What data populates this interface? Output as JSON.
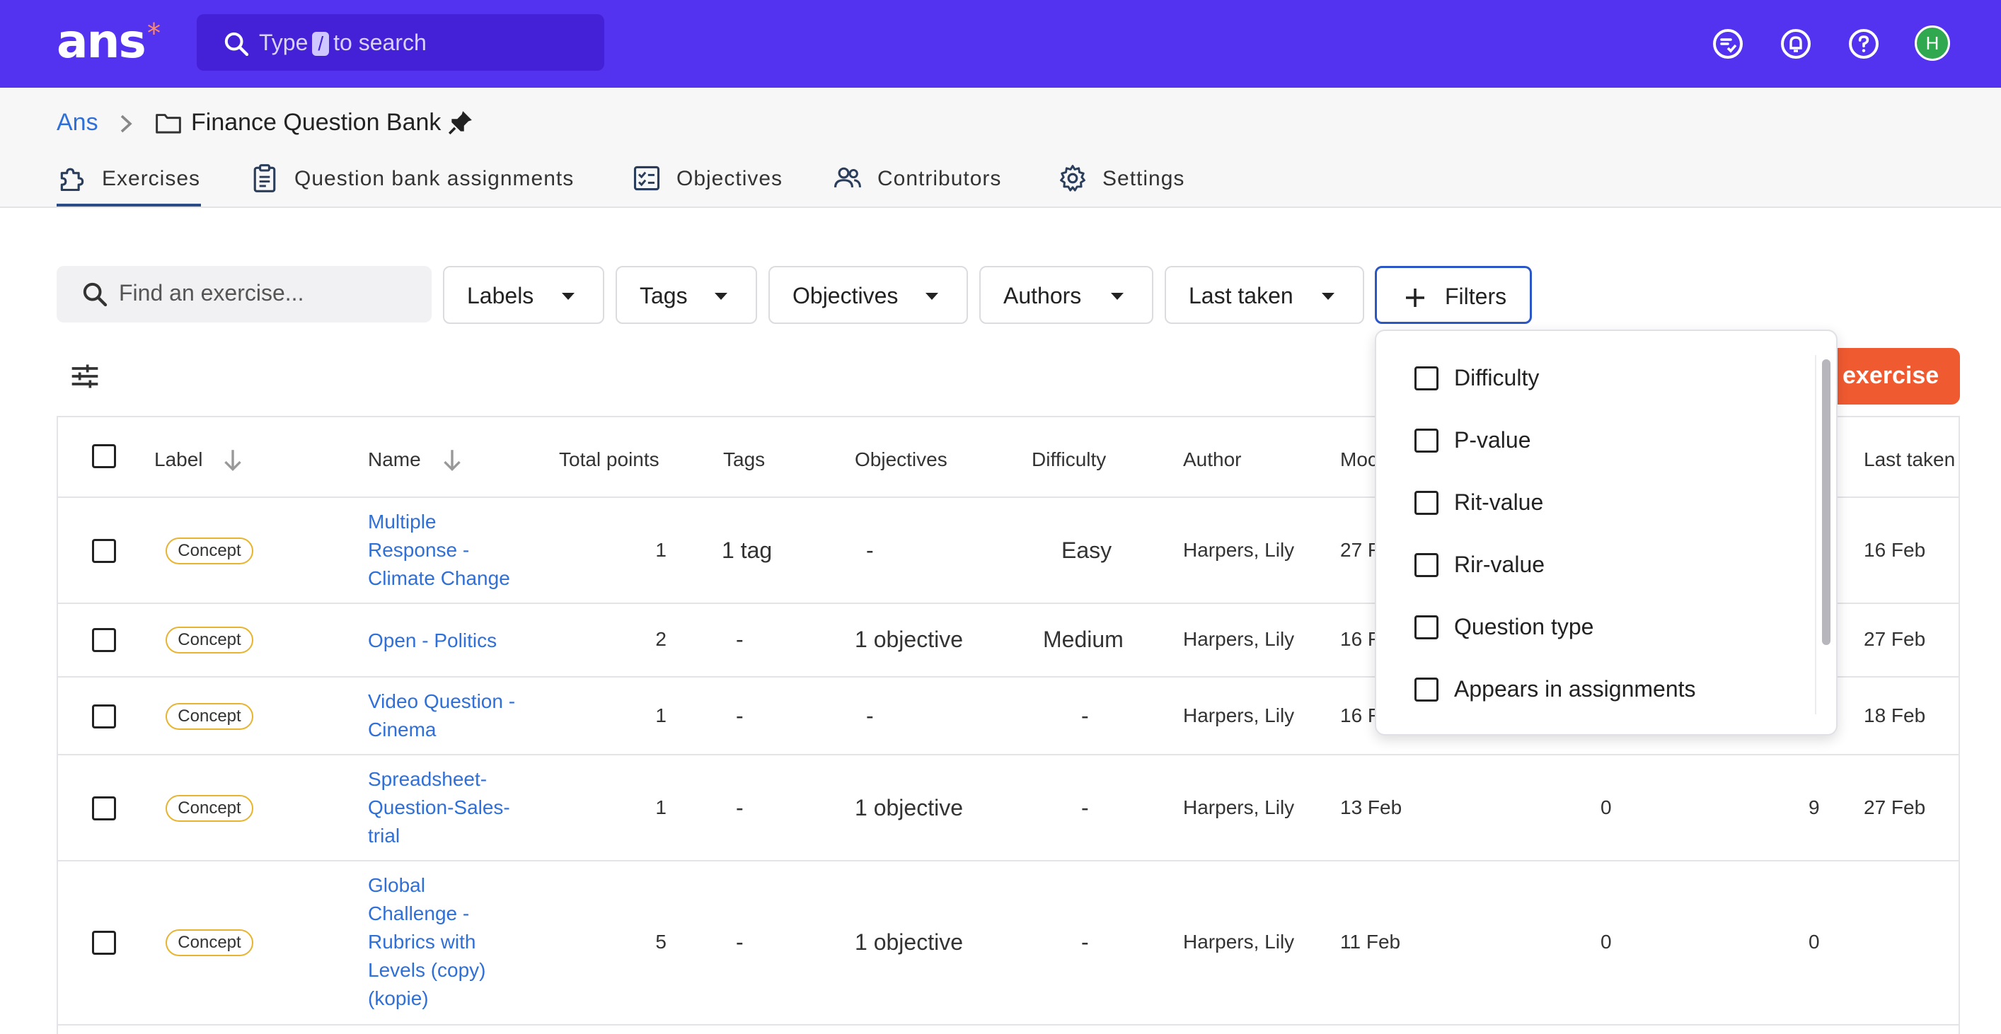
{
  "app": {
    "logo": "ans",
    "logo_star": "*",
    "search_prefix": "Type",
    "search_key": "/",
    "search_suffix": "to search",
    "avatar_initial": "H"
  },
  "breadcrumb": {
    "root": "Ans",
    "title": "Finance Question Bank"
  },
  "tabs": [
    {
      "label": "Exercises",
      "icon": "puzzle-icon",
      "active": true
    },
    {
      "label": "Question bank assignments",
      "icon": "clipboard-icon"
    },
    {
      "label": "Objectives",
      "icon": "checklist-icon"
    },
    {
      "label": "Contributors",
      "icon": "people-icon"
    },
    {
      "label": "Settings",
      "icon": "gear-icon"
    }
  ],
  "filters": {
    "search_placeholder": "Find an exercise...",
    "labels": "Labels",
    "tags": "Tags",
    "objectives": "Objectives",
    "authors": "Authors",
    "last_taken": "Last taken",
    "filters": "Filters"
  },
  "new_exercise_label": "exercise",
  "table": {
    "headers": {
      "label": "Label",
      "name": "Name",
      "total_points": "Total points",
      "tags": "Tags",
      "objectives": "Objectives",
      "difficulty": "Difficulty",
      "author": "Author",
      "modified": "Moc",
      "last_taken": "Last taken"
    },
    "rows": [
      {
        "label": "Concept",
        "name": "Multiple Response - Climate Change",
        "points": "1",
        "tags": "1 tag",
        "objectives": "-",
        "difficulty": "Easy",
        "author": "Harpers, Lily",
        "modified": "27 F",
        "col_a": "",
        "col_b": "",
        "last_taken": "16 Feb"
      },
      {
        "label": "Concept",
        "name": "Open - Politics",
        "points": "2",
        "tags": "-",
        "objectives": "1 objective",
        "difficulty": "Medium",
        "author": "Harpers, Lily",
        "modified": "16 F",
        "col_a": "",
        "col_b": "",
        "last_taken": "27 Feb"
      },
      {
        "label": "Concept",
        "name": "Video Question - Cinema",
        "points": "1",
        "tags": "-",
        "objectives": "-",
        "difficulty": "-",
        "author": "Harpers, Lily",
        "modified": "16 F",
        "col_a": "",
        "col_b": "",
        "last_taken": "18 Feb"
      },
      {
        "label": "Concept",
        "name": "Spreadsheet-Question-Sales-trial",
        "points": "1",
        "tags": "-",
        "objectives": "1 objective",
        "difficulty": "-",
        "author": "Harpers, Lily",
        "modified": "13 Feb",
        "col_a": "0",
        "col_b": "9",
        "last_taken": "27 Feb"
      },
      {
        "label": "Concept",
        "name": "Global Challenge - Rubrics with Levels (copy) (kopie)",
        "points": "5",
        "tags": "-",
        "objectives": "1 objective",
        "difficulty": "-",
        "author": "Harpers, Lily",
        "modified": "11 Feb",
        "col_a": "0",
        "col_b": "0",
        "last_taken": ""
      }
    ]
  },
  "filter_menu": {
    "options": [
      "Difficulty",
      "P-value",
      "Rit-value",
      "Rir-value",
      "Question type",
      "Appears in assignments"
    ]
  }
}
